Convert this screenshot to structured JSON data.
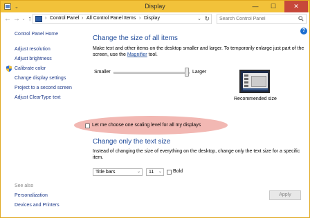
{
  "window": {
    "title": "Display"
  },
  "addressbar": {
    "crumbs": [
      "Control Panel",
      "All Control Panel Items",
      "Display"
    ],
    "search_placeholder": "Search Control Panel"
  },
  "sidebar": {
    "home": "Control Panel Home",
    "items": [
      "Adjust resolution",
      "Adjust brightness",
      "Calibrate color",
      "Change display settings",
      "Project to a second screen",
      "Adjust ClearType text"
    ],
    "see_also_heading": "See also",
    "see_also": [
      "Personalization",
      "Devices and Printers"
    ]
  },
  "main": {
    "heading1": "Change the size of all items",
    "para1_a": "Make text and other items on the desktop smaller and larger. To temporarily enlarge just part of the screen, use the",
    "para1_link": "Magnifier",
    "para1_b": "tool.",
    "slider": {
      "min_label": "Smaller",
      "max_label": "Larger",
      "value_fraction": 0.95
    },
    "preview_label": "Recommended size",
    "scaling_checkbox": {
      "label": "Let me choose one scaling level for all my displays",
      "checked": false
    },
    "heading2": "Change only the text size",
    "para2": "Instead of changing the size of everything on the desktop, change only the text size for a specific item.",
    "item_select": "Title bars",
    "size_select": "11",
    "bold_checkbox": {
      "label": "Bold",
      "checked": false
    },
    "apply_label": "Apply"
  },
  "colors": {
    "titlebar": "#f2c23a",
    "link": "#1e3a8a",
    "heading": "#1e4a9a",
    "highlight": "#f2b8b3",
    "close": "#c7483a"
  }
}
